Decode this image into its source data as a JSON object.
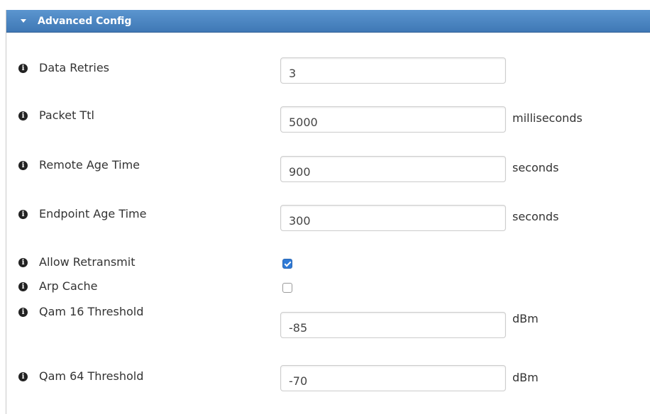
{
  "panel": {
    "title": "Advanced Config"
  },
  "fields": [
    {
      "label": "Data Retries",
      "value": "3",
      "unit": ""
    },
    {
      "label": "Packet Ttl",
      "value": "5000",
      "unit": "milliseconds"
    },
    {
      "label": "Remote Age Time",
      "value": "900",
      "unit": "seconds"
    },
    {
      "label": "Endpoint Age Time",
      "value": "300",
      "unit": "seconds"
    },
    {
      "label": "Allow Retransmit",
      "checked": true
    },
    {
      "label": "Arp Cache",
      "checked": false
    },
    {
      "label": "Qam 16 Threshold",
      "value": "-85",
      "unit": "dBm"
    },
    {
      "label": "Qam 64 Threshold",
      "value": "-70",
      "unit": "dBm"
    }
  ],
  "icons": {
    "info": "info-icon",
    "caret": "caret-down-icon",
    "info_glyph": "i"
  },
  "colors": {
    "header": "#4a86c5",
    "checkbox_checked": "#2f7ad6"
  }
}
